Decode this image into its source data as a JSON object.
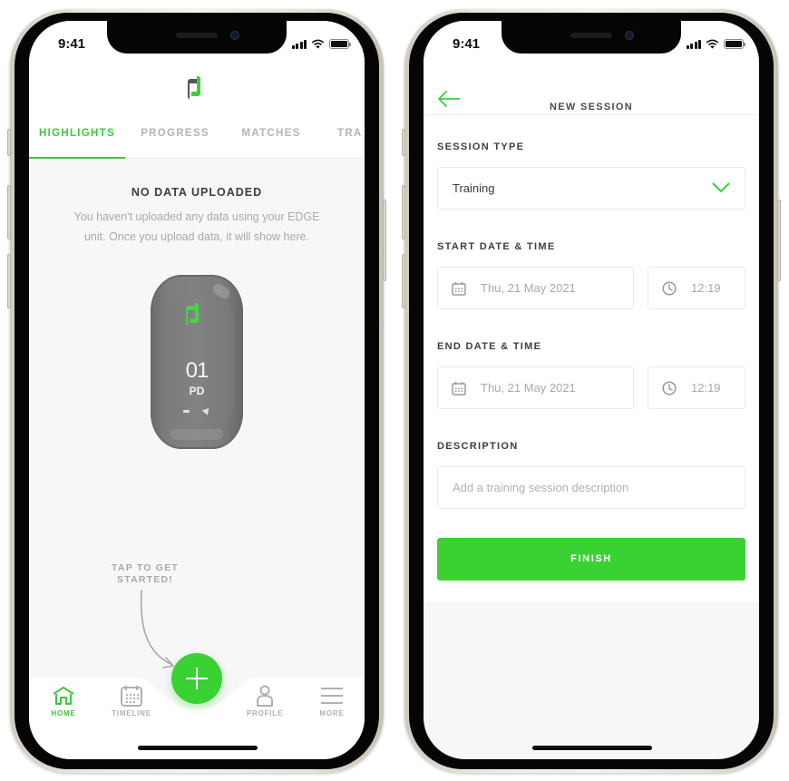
{
  "status_bar": {
    "time": "9:41"
  },
  "screen_home": {
    "tabs": [
      {
        "label": "HIGHLIGHTS",
        "active": true
      },
      {
        "label": "PROGRESS",
        "active": false
      },
      {
        "label": "MATCHES",
        "active": false
      },
      {
        "label": "TRA",
        "active": false
      }
    ],
    "empty_state": {
      "title": "NO DATA UPLOADED",
      "text": "You haven't uploaded any data using your EDGE unit. Once you upload data, it will show here."
    },
    "device": {
      "number": "01",
      "code": "PD"
    },
    "hint": "TAP TO GET STARTED!",
    "fab_icon": "plus-icon",
    "nav": [
      {
        "label": "HOME",
        "icon": "home-icon",
        "active": true
      },
      {
        "label": "TIMELINE",
        "icon": "calendar-icon",
        "active": false
      },
      {
        "label": "PROFILE",
        "icon": "person-icon",
        "active": false
      },
      {
        "label": "MORE",
        "icon": "menu-icon",
        "active": false
      }
    ]
  },
  "screen_new_session": {
    "title": "NEW SESSION",
    "back_icon": "arrow-left-icon",
    "session_type": {
      "label": "SESSION TYPE",
      "value": "Training"
    },
    "start": {
      "label": "START DATE & TIME",
      "date": "Thu, 21 May 2021",
      "time": "12:19"
    },
    "end": {
      "label": "END DATE & TIME",
      "date": "Thu, 21 May 2021",
      "time": "12:19"
    },
    "description": {
      "label": "DESCRIPTION",
      "placeholder": "Add a training session description"
    },
    "finish_label": "FINISH"
  },
  "colors": {
    "accent": "#3ad133",
    "logo_dark": "#555555",
    "muted_text": "#aaaaaa",
    "background": "#f7f7f7"
  }
}
